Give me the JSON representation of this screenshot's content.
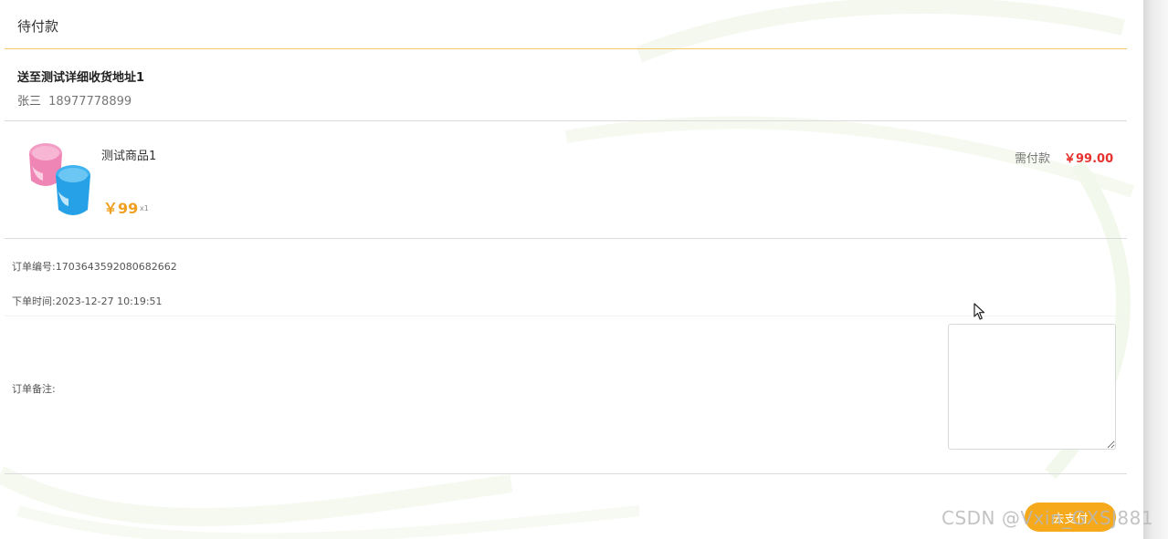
{
  "order": {
    "status_title": "待付款",
    "address": "送至测试详细收货地址1",
    "receiver_name": "张三",
    "receiver_phone": "18977778899",
    "product": {
      "name": "测试商品1",
      "price": "￥99",
      "quantity": "x1",
      "image_icon": "cup-product-image"
    },
    "payment": {
      "label": "需付款",
      "amount": "￥99.00"
    },
    "order_no_label": "订单编号:",
    "order_no": "1703643592080682662",
    "order_time_label": "下单时间:",
    "order_time": "2023-12-27 10:19:51",
    "remark_label": "订单备注:",
    "remark_value": "",
    "pay_button_label": "去支付"
  },
  "watermark": "CSDN @Vxin_GXSJ881",
  "colors": {
    "accent_orange": "#f6a91a",
    "price_orange": "#f0a020",
    "price_red": "#e6322e",
    "divider_orange": "#f5c96a"
  }
}
